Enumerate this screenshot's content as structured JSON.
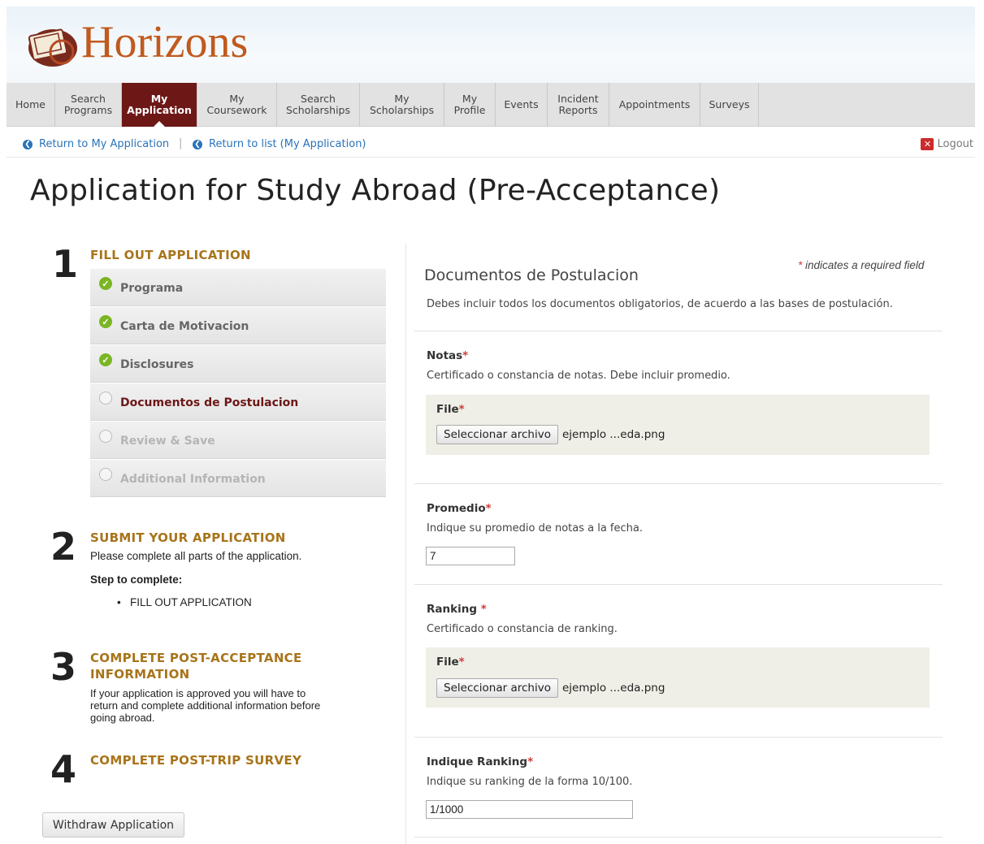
{
  "brand": {
    "name": "Horizons"
  },
  "nav": {
    "items": [
      "Home",
      "Search\nPrograms",
      "My\nApplication",
      "My\nCoursework",
      "Search\nScholarships",
      "My\nScholarships",
      "My\nProfile",
      "Events",
      "Incident\nReports",
      "Appointments",
      "Surveys"
    ],
    "active": "My Application"
  },
  "subnav": {
    "return_app": "Return to My Application",
    "separator": "|",
    "return_list": "Return to list (My Application)",
    "logout": "Logout"
  },
  "page": {
    "title": "Application for Study Abroad (Pre-Acceptance)"
  },
  "steps": {
    "step1": {
      "num": "1",
      "title": "FILL OUT APPLICATION"
    },
    "step2": {
      "num": "2",
      "title": "SUBMIT YOUR APPLICATION",
      "text": "Please complete all parts of the application.",
      "subhead": "Step to complete:",
      "bullet": "FILL OUT APPLICATION"
    },
    "step3": {
      "num": "3",
      "title_line1": "COMPLETE POST-ACCEPTANCE",
      "title_line2": "INFORMATION",
      "text_line1": "If your application is approved you will have to",
      "text_line2": "return and complete additional information before",
      "text_line3": "going abroad."
    },
    "step4": {
      "num": "4",
      "title": "COMPLETE POST-TRIP SURVEY"
    }
  },
  "sections": [
    {
      "label": "Programa",
      "status": "complete"
    },
    {
      "label": "Carta de Motivacion",
      "status": "complete"
    },
    {
      "label": "Disclosures",
      "status": "complete"
    },
    {
      "label": "Documentos de Postulacion",
      "status": "current"
    },
    {
      "label": "Review & Save",
      "status": "disabled"
    },
    {
      "label": "Additional Information",
      "status": "disabled"
    }
  ],
  "withdraw_label": "Withdraw Application",
  "form": {
    "required_note": "indicates a required field",
    "required_star": "*",
    "section_title": "Documentos de Postulacion",
    "section_desc": "Debes incluir todos los documentos obligatorios, de acuerdo a las bases de postulación.",
    "notas": {
      "label": "Notas",
      "desc": "Certificado o constancia de notas. Debe incluir promedio.",
      "file_label": "File",
      "button": "Seleccionar archivo",
      "file_name": "ejemplo ...eda.png"
    },
    "promedio": {
      "label": "Promedio",
      "desc": "Indique su promedio de notas a la fecha.",
      "value": "7"
    },
    "ranking": {
      "label": "Ranking",
      "desc": "Certificado o constancia de ranking.",
      "file_label": "File",
      "button": "Seleccionar archivo",
      "file_name": "ejemplo ...eda.png"
    },
    "indique_ranking": {
      "label": "Indique Ranking",
      "desc": "Indique su ranking de la forma 10/100.",
      "value": "1/1000"
    }
  },
  "colors": {
    "accent": "#6d1717",
    "step_heading": "#a8741a",
    "link": "#2a73b8",
    "complete": "#7ab523",
    "required": "#d03a3a"
  }
}
